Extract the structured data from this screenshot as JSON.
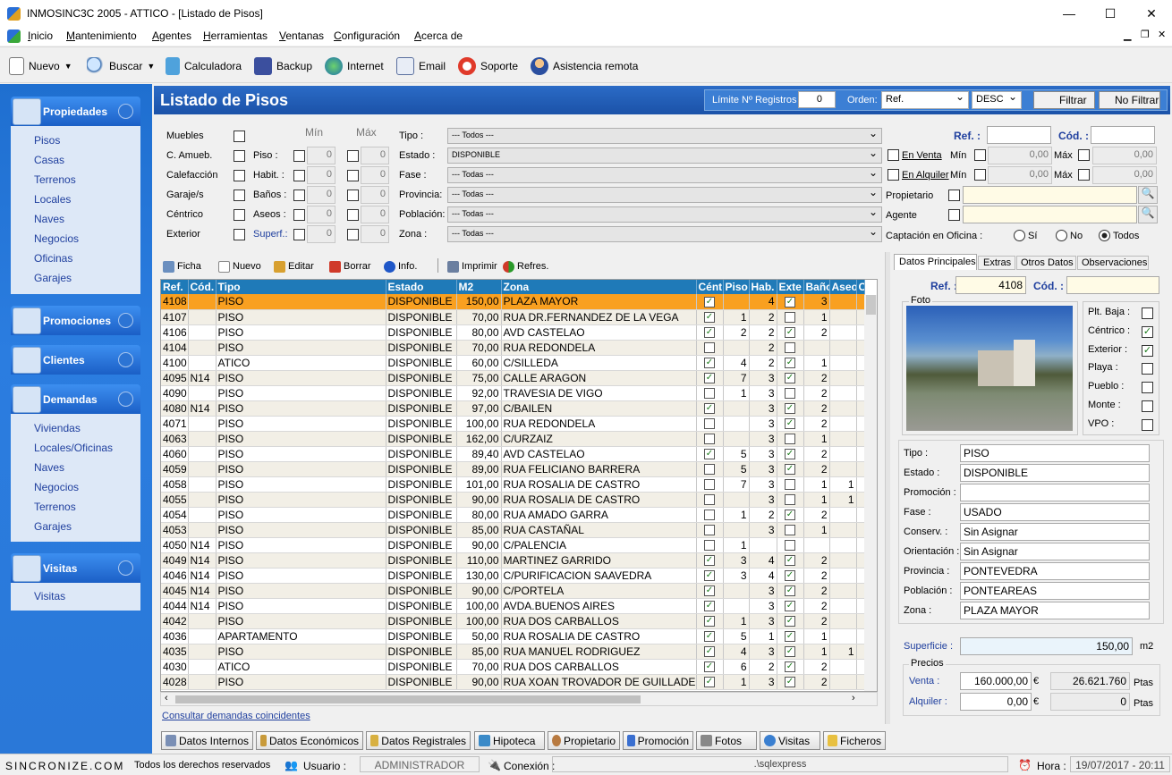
{
  "window": {
    "title": "INMOSINC3C 2005   -  ATTICO - [Listado de Pisos]",
    "minimize": "—",
    "maximize": "☐",
    "close": "✕"
  },
  "menu": [
    "Inicio",
    "Mantenimiento",
    "Agentes",
    "Herramientas",
    "Ventanas",
    "Configuración",
    "Acerca de"
  ],
  "toolbar": {
    "nuevo": "Nuevo",
    "buscar": "Buscar",
    "calculadora": "Calculadora",
    "backup": "Backup",
    "internet": "Internet",
    "email": "Email",
    "soporte": "Soporte",
    "asistencia": "Asistencia remota"
  },
  "sidebar": {
    "propiedades": {
      "title": "Propiedades",
      "items": [
        "Pisos",
        "Casas",
        "Terrenos",
        "Locales",
        "Naves",
        "Negocios",
        "Oficinas",
        "Garajes"
      ]
    },
    "promociones": {
      "title": "Promociones"
    },
    "clientes": {
      "title": "Clientes"
    },
    "demandas": {
      "title": "Demandas",
      "items": [
        "Viviendas",
        "Locales/Oficinas",
        "Naves",
        "Negocios",
        "Terrenos",
        "Garajes"
      ]
    },
    "visitas": {
      "title": "Visitas",
      "items": [
        "Visitas"
      ]
    }
  },
  "header": {
    "title": "Listado de Pisos",
    "limite_label": "Límite Nº Registros :",
    "limite_value": "0",
    "orden_label": "Orden:",
    "orden_value": "Ref.",
    "dir_value": "DESC",
    "filtrar": "Filtrar",
    "no_filtrar": "No Filtrar"
  },
  "filters": {
    "min": "Mín",
    "max": "Máx",
    "left_labels": [
      "Muebles",
      "C. Amueb.",
      "Calefacción",
      "Garaje/s",
      "Céntrico",
      "Exterior"
    ],
    "range_labels": [
      "Piso :",
      "Habit. :",
      "Baños :",
      "Aseos :",
      "Superf.:"
    ],
    "range_zero": "0",
    "tipo_label": "Tipo :",
    "tipo": "--- Todos ---",
    "estado_label": "Estado :",
    "estado": "DISPONIBLE",
    "fase_label": "Fase :",
    "fase": "--- Todas ---",
    "provincia_label": "Provincia:",
    "provincia": "--- Todas ---",
    "poblacion_label": "Población:",
    "poblacion": "--- Todas ---",
    "zona_label": "Zona :",
    "zona": "--- Todas ---",
    "ref_label": "Ref. :",
    "cod_label": "Cód. :",
    "en_venta": "En Venta",
    "en_alquiler": "En Alquiler",
    "min_l": "Mín",
    "max_l": "Máx",
    "zero_money": "0,00",
    "propietario": "Propietario",
    "agente": "Agente",
    "captacion": "Captación en Oficina :",
    "si": "Sí",
    "no": "No",
    "todos": "Todos"
  },
  "actions": {
    "ficha": "Ficha",
    "nuevo": "Nuevo",
    "editar": "Editar",
    "borrar": "Borrar",
    "info": "Info.",
    "imprimir": "Imprimir",
    "refres": "Refres."
  },
  "grid": {
    "columns": [
      "Ref.",
      "Cód.",
      "Tipo",
      "Estado",
      "M2",
      "Zona",
      "Cént",
      "Piso",
      "Hab.",
      "Exte",
      "Baño",
      "Aseo",
      "C"
    ],
    "rows": [
      [
        "4108",
        "",
        "PISO",
        "DISPONIBLE",
        "150,00",
        "PLAZA MAYOR",
        1,
        "",
        "4",
        1,
        "3",
        ""
      ],
      [
        "4107",
        "",
        "PISO",
        "DISPONIBLE",
        "70,00",
        "RUA DR.FERNANDEZ DE LA VEGA",
        1,
        "1",
        "2",
        0,
        "1",
        ""
      ],
      [
        "4106",
        "",
        "PISO",
        "DISPONIBLE",
        "80,00",
        "AVD CASTELAO",
        1,
        "2",
        "2",
        1,
        "2",
        ""
      ],
      [
        "4104",
        "",
        "PISO",
        "DISPONIBLE",
        "70,00",
        "RUA REDONDELA",
        0,
        "",
        "2",
        0,
        "",
        ""
      ],
      [
        "4100",
        "",
        "ATICO",
        "DISPONIBLE",
        "60,00",
        "C/SILLEDA",
        1,
        "4",
        "2",
        1,
        "1",
        ""
      ],
      [
        "4095",
        "N14",
        "PISO",
        "DISPONIBLE",
        "75,00",
        "CALLE ARAGON",
        1,
        "7",
        "3",
        1,
        "2",
        ""
      ],
      [
        "4090",
        "",
        "PISO",
        "DISPONIBLE",
        "92,00",
        "TRAVESIA DE VIGO",
        0,
        "1",
        "3",
        0,
        "2",
        ""
      ],
      [
        "4080",
        "N14",
        "PISO",
        "DISPONIBLE",
        "97,00",
        "C/BAILEN",
        1,
        "",
        "3",
        1,
        "2",
        ""
      ],
      [
        "4071",
        "",
        "PISO",
        "DISPONIBLE",
        "100,00",
        "RUA REDONDELA",
        0,
        "",
        "3",
        1,
        "2",
        ""
      ],
      [
        "4063",
        "",
        "PISO",
        "DISPONIBLE",
        "162,00",
        "C/URZAIZ",
        0,
        "",
        "3",
        0,
        "1",
        ""
      ],
      [
        "4060",
        "",
        "PISO",
        "DISPONIBLE",
        "89,40",
        "AVD CASTELAO",
        1,
        "5",
        "3",
        1,
        "2",
        ""
      ],
      [
        "4059",
        "",
        "PISO",
        "DISPONIBLE",
        "89,00",
        "RUA FELICIANO BARRERA",
        0,
        "5",
        "3",
        1,
        "2",
        ""
      ],
      [
        "4058",
        "",
        "PISO",
        "DISPONIBLE",
        "101,00",
        "RUA ROSALIA DE CASTRO",
        0,
        "7",
        "3",
        0,
        "1",
        "1"
      ],
      [
        "4055",
        "",
        "PISO",
        "DISPONIBLE",
        "90,00",
        "RUA ROSALIA DE CASTRO",
        0,
        "",
        "3",
        0,
        "1",
        "1"
      ],
      [
        "4054",
        "",
        "PISO",
        "DISPONIBLE",
        "80,00",
        "RUA AMADO GARRA",
        0,
        "1",
        "2",
        1,
        "2",
        ""
      ],
      [
        "4053",
        "",
        "PISO",
        "DISPONIBLE",
        "85,00",
        "RUA  CASTAÑAL",
        0,
        "",
        "3",
        0,
        "1",
        ""
      ],
      [
        "4050",
        "N14",
        "PISO",
        "DISPONIBLE",
        "90,00",
        "C/PALENCIA",
        0,
        "1",
        "",
        0,
        "",
        ""
      ],
      [
        "4049",
        "N14",
        "PISO",
        "DISPONIBLE",
        "110,00",
        "MARTINEZ GARRIDO",
        1,
        "3",
        "4",
        1,
        "2",
        ""
      ],
      [
        "4046",
        "N14",
        "PISO",
        "DISPONIBLE",
        "130,00",
        "C/PURIFICACION SAAVEDRA",
        1,
        "3",
        "4",
        1,
        "2",
        ""
      ],
      [
        "4045",
        "N14",
        "PISO",
        "DISPONIBLE",
        "90,00",
        "C/PORTELA",
        1,
        "",
        "3",
        1,
        "2",
        ""
      ],
      [
        "4044",
        "N14",
        "PISO",
        "DISPONIBLE",
        "100,00",
        "AVDA.BUENOS AIRES",
        1,
        "",
        "3",
        1,
        "2",
        ""
      ],
      [
        "4042",
        "",
        "PISO",
        "DISPONIBLE",
        "100,00",
        "RUA DOS CARBALLOS",
        1,
        "1",
        "3",
        1,
        "2",
        ""
      ],
      [
        "4036",
        "",
        "APARTAMENTO",
        "DISPONIBLE",
        "50,00",
        "RUA ROSALIA DE CASTRO",
        1,
        "5",
        "1",
        1,
        "1",
        ""
      ],
      [
        "4035",
        "",
        "PISO",
        "DISPONIBLE",
        "85,00",
        "RUA MANUEL RODRIGUEZ",
        1,
        "4",
        "3",
        1,
        "1",
        "1"
      ],
      [
        "4030",
        "",
        "ATICO",
        "DISPONIBLE",
        "70,00",
        "RUA DOS CARBALLOS",
        1,
        "6",
        "2",
        1,
        "2",
        ""
      ],
      [
        "4028",
        "",
        "PISO",
        "DISPONIBLE",
        "90,00",
        "RUA XOAN TROVADOR DE GUILLADE",
        1,
        "1",
        "3",
        1,
        "2",
        ""
      ]
    ]
  },
  "consultar": "Consultar demandas coincidentes",
  "detail": {
    "tabs": [
      "Datos Principales",
      "Extras",
      "Otros Datos",
      "Observaciones"
    ],
    "ref_label": "Ref. :",
    "ref": "4108",
    "cod_label": "Cód. :",
    "cod": "",
    "foto": "Foto",
    "flags": [
      [
        "Plt. Baja :",
        0
      ],
      [
        "Céntrico :",
        1
      ],
      [
        "Exterior :",
        1
      ],
      [
        "Playa :",
        0
      ],
      [
        "Pueblo :",
        0
      ],
      [
        "Monte :",
        0
      ],
      [
        "VPO :",
        0
      ]
    ],
    "fields": [
      [
        "Tipo :",
        "PISO"
      ],
      [
        "Estado :",
        "DISPONIBLE"
      ],
      [
        "Promoción :",
        ""
      ],
      [
        "Fase :",
        "USADO"
      ],
      [
        "Conserv. :",
        "Sin Asignar"
      ],
      [
        "Orientación :",
        "Sin Asignar"
      ],
      [
        "Provincia :",
        "PONTEVEDRA"
      ],
      [
        "Población :",
        "PONTEAREAS"
      ],
      [
        "Zona :",
        "PLAZA MAYOR"
      ]
    ],
    "superficie_label": "Superficie :",
    "superficie": "150,00",
    "m2": "m2",
    "precios": "Precios",
    "venta_label": "Venta :",
    "venta": "160.000,00",
    "euro": "€",
    "venta_ptas": "26.621.760",
    "ptas": "Ptas",
    "alquiler_label": "Alquiler :",
    "alquiler": "0,00",
    "alquiler_ptas": "0"
  },
  "bottom_tabs": [
    "Datos Internos",
    "Datos Económicos",
    "Datos Registrales",
    "Hipoteca",
    "Propietario",
    "Promoción",
    "Fotos",
    "Visitas",
    "Ficheros"
  ],
  "status": {
    "brand": "SINCRONIZE.COM",
    "rights": "Todos los derechos reservados",
    "usuario_label": "Usuario :",
    "usuario": "ADMINISTRADOR",
    "conexion_label": "Conexión :",
    "conexion": ".\\sqlexpress",
    "hora_label": "Hora :",
    "hora": "19/07/2017 - 20:11"
  },
  "colors": {
    "header_blue": "#1f5bb0",
    "grid_header": "#1f7ab8",
    "selected_row": "#f9a020"
  }
}
